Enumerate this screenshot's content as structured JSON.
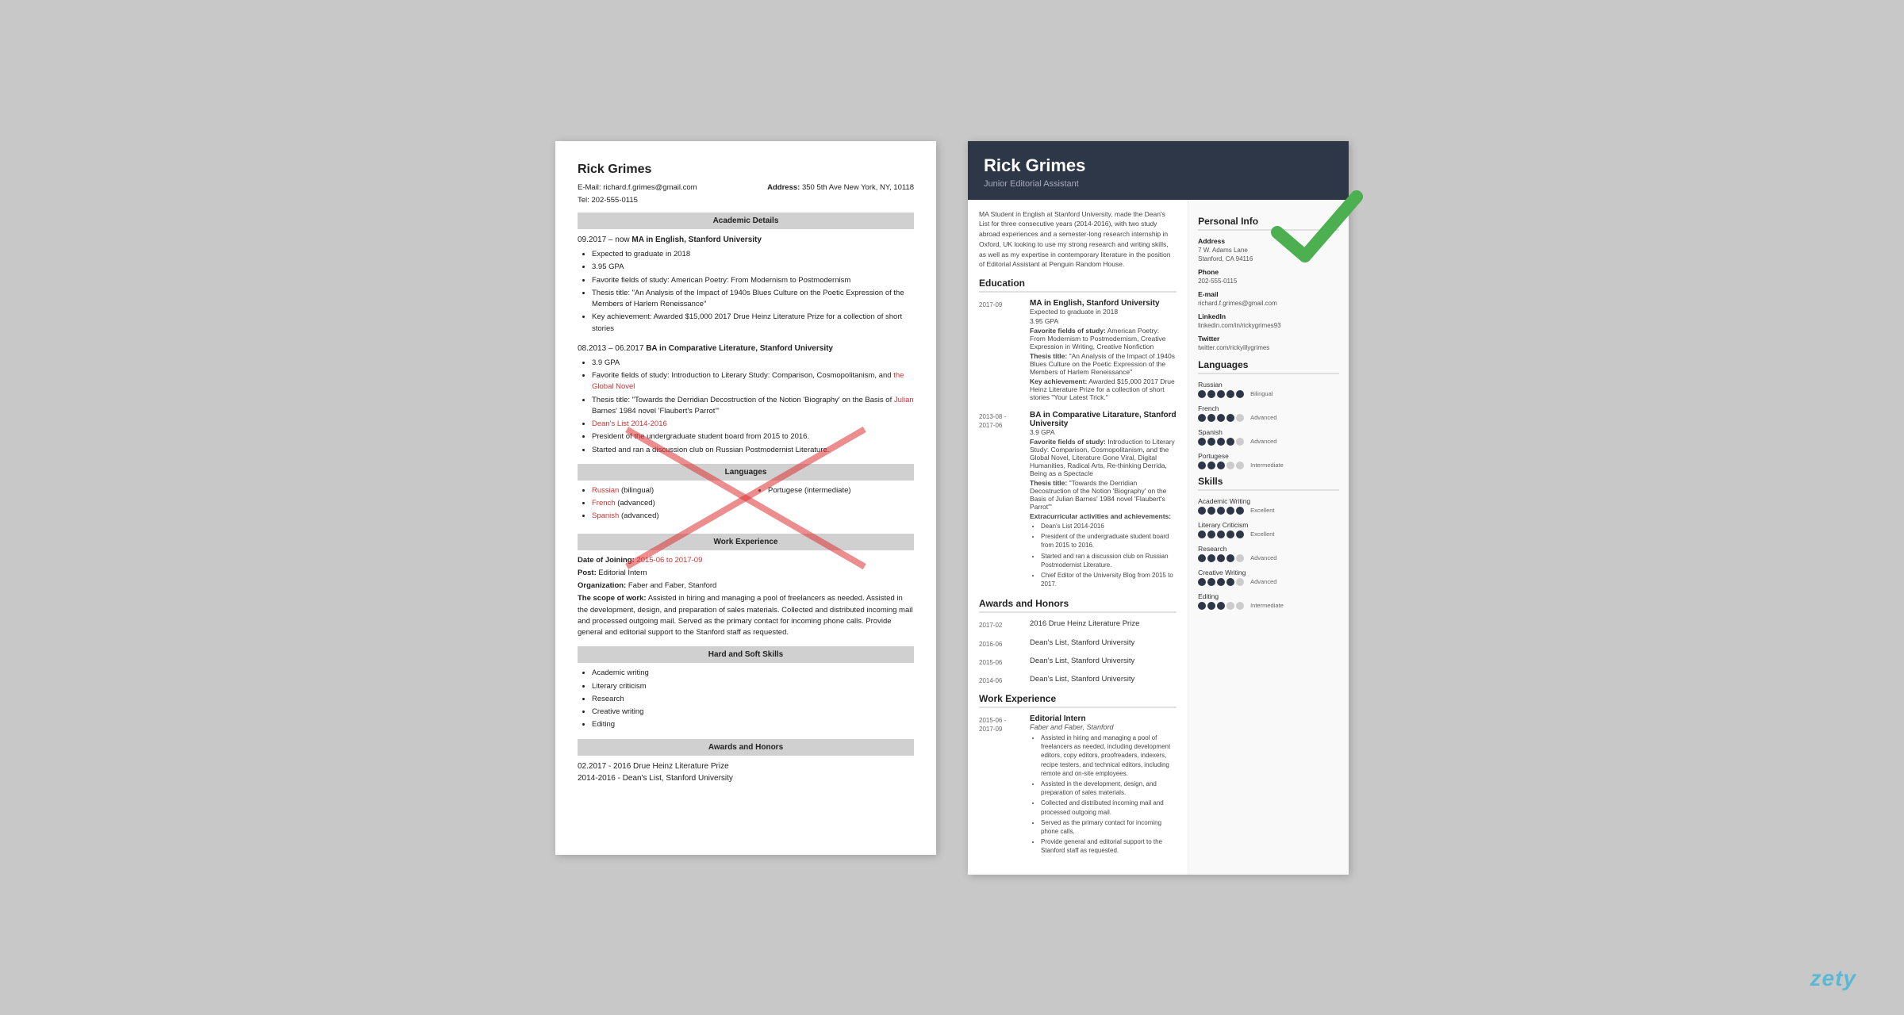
{
  "page": {
    "background_color": "#c8c8c8",
    "watermark": "zety"
  },
  "left_resume": {
    "name": "Rick Grimes",
    "email_label": "E-Mail:",
    "email": "richard.f.grimes@gmail.com",
    "address_label": "Address:",
    "address": "350 5th Ave New York, NY, 10118",
    "tel_label": "Tel:",
    "tel": "202-555-0115",
    "sections": {
      "academic_details": "Academic Details",
      "languages": "Languages",
      "work_experience": "Work Experience",
      "hard_soft_skills": "Hard and Soft Skills",
      "awards_honors": "Awards and Honors"
    },
    "education": [
      {
        "dates": "09.2017 – now",
        "degree": "MA in English, Stanford University",
        "bullets": [
          "Expected to graduate in 2018",
          "3.95 GPA",
          "Favorite fields of study: American Poetry: From Modernism to Postmodernism",
          "Thesis title: \"An Analysis of the Impact of 1940s Blues Culture on the Poetic Expression of the Members of Harlem Reneissance\"",
          "Key achievement: Awarded $15,000 2017 Drue Heinz Literature Prize for a collection of short stories"
        ]
      },
      {
        "dates": "08.2013 – 06.2017",
        "degree": "BA in Comparative Literature, Stanford University",
        "bullets": [
          "3.9 GPA",
          "Favorite fields of study: Introduction to Literary Study: Comparison, Cosmopolitanism, and the Global Novel",
          "Thesis title: \"Towards the Derridian Decostruction of the Notion 'Biography' on the Basis of Julian Barnes' 1984 novel 'Flaubert's Parrot'\"",
          "Dean's List 2014-2016",
          "President of the undergraduate student board from 2015 to 2016.",
          "Started and ran a discussion club on Russian Postmodernist Literature."
        ]
      }
    ],
    "languages": [
      {
        "name": "Russian",
        "level": "(bilingual)"
      },
      {
        "name": "French",
        "level": "(advanced)"
      },
      {
        "name": "Spanish",
        "level": "(advanced)"
      },
      {
        "name": "Portugese",
        "level": "(intermediate)"
      }
    ],
    "work_experience": {
      "dates": "2015-06 to 2017-09",
      "post": "Editorial Intern",
      "organization": "Faber and Faber, Stanford",
      "scope": "Assisted in hiring and managing a pool of freelancers as needed. Assisted in the development, design, and preparation of sales materials. Collected and distributed incoming mail and processed outgoing mail. Served as the primary contact for incoming phone calls. Provide general and editorial support to the Stanford staff as requested."
    },
    "skills": [
      "Academic writing",
      "Literary criticism",
      "Research",
      "Creative writing",
      "Editing"
    ],
    "awards": [
      "02.2017 - 2016 Drue Heinz Literature Prize",
      "2014-2016 - Dean's List, Stanford University"
    ]
  },
  "right_resume": {
    "name": "Rick Grimes",
    "subtitle": "Junior Editorial Assistant",
    "summary": "MA Student in English at Stanford University, made the Dean's List for three consecutive years (2014-2016), with two study abroad experiences and a semester-long research internship in Oxford, UK looking to use my strong research and writing skills, as well as my expertise in contemporary literature in the position of Editorial Assistant at Penguin Random House.",
    "education_section": "Education",
    "education": [
      {
        "dates": "2017-09",
        "degree": "MA in English, Stanford University",
        "details": [
          "Expected to graduate in 2018",
          "3.95 GPA",
          "Favorite fields of study: American Poetry: From Modernism to Postmodernism, Creative Expression in Writing, Creative Nonfiction",
          "Thesis title: \"An Analysis of the Impact of 1940s Blues Culture on the Poetic Expression of the Members of Harlem Reneissance\"",
          "Key achievement: Awarded $15,000 2017 Drue Heinz Literature Prize for a collection of short stories \"Your Latest Trick.\""
        ]
      },
      {
        "dates": "2013-08 - 2017-06",
        "degree": "BA in Comparative Litarature, Stanford University",
        "gpa": "3.9 GPA",
        "details": [
          "Favorite fields of study: Introduction to Literary Study: Comparison, Cosmopolitanism, and the Global Novel, Literature Gone Viral, Digital Humanities, Radical Arts, Re-thinking Derrida, Being as a Spectacle",
          "Thesis title: \"Towards the Derridian Decostruction of the Notion 'Biography' on the Basis of Julian Barnes' 1984 novel 'Flaubert's Parrot'\""
        ],
        "extracurricular_label": "Extracurricular activities and achievements:",
        "extracurricular": [
          "Dean's List 2014-2016",
          "President of the undergraduate student board from 2015 to 2016.",
          "Started and ran a discussion club on Russian Postmodernist Literature.",
          "Chief Editor of the University Blog from 2015 to 2017."
        ]
      }
    ],
    "awards_section": "Awards and Honors",
    "awards": [
      {
        "dates": "2017-02",
        "item": "2016 Drue Heinz Literature Prize"
      },
      {
        "dates": "2016-06",
        "item": "Dean's List, Stanford University"
      },
      {
        "dates": "2015-06",
        "item": "Dean's List, Stanford University"
      },
      {
        "dates": "2014-06",
        "item": "Dean's List, Stanford University"
      }
    ],
    "work_section": "Work Experience",
    "work": [
      {
        "dates": "2015-06 - 2017-09",
        "title": "Editorial Intern",
        "company": "Faber and Faber, Stanford",
        "bullets": [
          "Assisted in hiring and managing a pool of freelancers as needed, including development editors, copy editors, proofreaders, indexers, recipe testers, and technical editors, including remote and on-site employees.",
          "Assisted in the development, design, and preparation of sales materials.",
          "Collected and distributed incoming mail and processed outgoing mail.",
          "Served as the primary contact for incoming phone calls.",
          "Provide general and editorial support to the Stanford staff as requested."
        ]
      }
    ],
    "sidebar": {
      "personal_info_title": "Personal Info",
      "personal_info": {
        "address_label": "Address",
        "address": "7 W. Adams Lane\nStanford, CA 94116",
        "phone_label": "Phone",
        "phone": "202-555-0115",
        "email_label": "E-mail",
        "email": "richard.f.grimes@gmail.com",
        "linkedin_label": "LinkedIn",
        "linkedin": "linkedin.com/in/rickygrimes93",
        "twitter_label": "Twitter",
        "twitter": "twitter.com/rickyillygrimes"
      },
      "languages_title": "Languages",
      "languages": [
        {
          "name": "Russian",
          "dots": 5,
          "level": "Bilingual"
        },
        {
          "name": "French",
          "dots": 4,
          "level": "Advanced"
        },
        {
          "name": "Spanish",
          "dots": 4,
          "level": "Advanced"
        },
        {
          "name": "Portugese",
          "dots": 3,
          "level": "Intermediate"
        }
      ],
      "skills_title": "Skills",
      "skills": [
        {
          "name": "Academic Writing",
          "dots": 5,
          "level": "Excellent"
        },
        {
          "name": "Literary Criticism",
          "dots": 5,
          "level": "Excellent"
        },
        {
          "name": "Research",
          "dots": 4,
          "level": "Advanced"
        },
        {
          "name": "Creative Writing",
          "dots": 4,
          "level": "Advanced"
        },
        {
          "name": "Editing",
          "dots": 3,
          "level": "Intermediate"
        }
      ]
    }
  }
}
